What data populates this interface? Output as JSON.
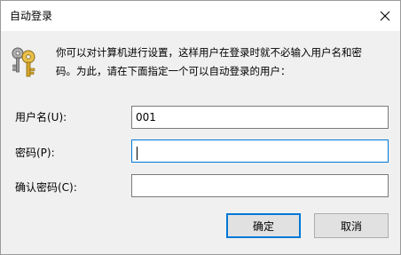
{
  "window": {
    "title": "自动登录"
  },
  "description": {
    "line1": "你可以对计算机进行设置，这样用户在登录时就不必输入用户名和密",
    "line2": "码。为此，请在下面指定一个可以自动登录的用户："
  },
  "form": {
    "username": {
      "label": "用户名(U):",
      "value": "001"
    },
    "password": {
      "label": "密码(P):",
      "value": ""
    },
    "confirm_password": {
      "label": "确认密码(C):",
      "value": ""
    }
  },
  "buttons": {
    "ok": "确定",
    "cancel": "取消"
  },
  "colors": {
    "accent": "#0078d7",
    "dialog_bg": "#f0f0f0",
    "key_gold": "#d4a52a",
    "key_gray": "#8a8a8a"
  },
  "icons": {
    "close": "close-icon",
    "keys": "keys-icon"
  }
}
